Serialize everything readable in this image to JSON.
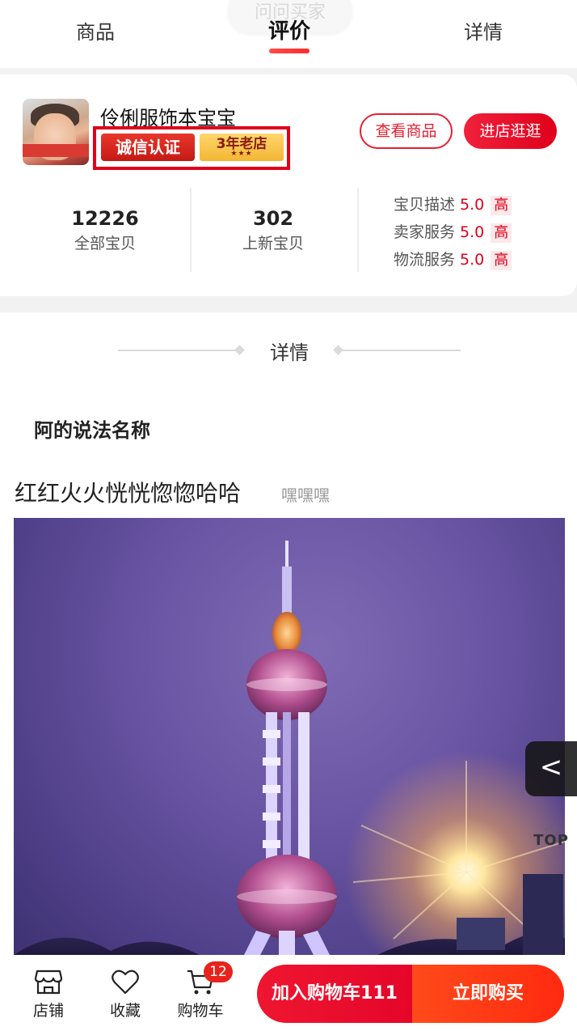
{
  "tabs": {
    "ghost_pill": "问问买家",
    "items": [
      {
        "label": "商品",
        "active": false
      },
      {
        "label": "评价",
        "active": true
      },
      {
        "label": "详情",
        "active": false
      }
    ]
  },
  "shop": {
    "name": "伶俐服饰本宝宝",
    "badge_certified": "诚信认证",
    "badge_years": "3年老店",
    "badge_stars": "★★★",
    "view_goods_label": "查看商品",
    "enter_store_label": "进店逛逛",
    "stats": [
      {
        "value": "12226",
        "label": "全部宝贝"
      },
      {
        "value": "302",
        "label": "上新宝贝"
      }
    ],
    "ratings": [
      {
        "label": "宝贝描述",
        "score": "5.0",
        "level": "高"
      },
      {
        "label": "卖家服务",
        "score": "5.0",
        "level": "高"
      },
      {
        "label": "物流服务",
        "score": "5.0",
        "level": "高"
      }
    ]
  },
  "details": {
    "section_title": "详情",
    "sub_heading": "阿的说法名称",
    "product_title": "红红火火恍恍惚惚哈哈",
    "product_subtitle": "嘿嘿嘿"
  },
  "floating": {
    "side_arrow": "<",
    "top_label": "TOP"
  },
  "bottom_bar": {
    "store_label": "店铺",
    "favorite_label": "收藏",
    "cart_label": "购物车",
    "cart_count": "12",
    "add_to_cart_label": "加入购物车111",
    "buy_now_label": "立即购买"
  },
  "colors": {
    "accent_red": "#e0001a",
    "buy_orange": "#ff3a16"
  }
}
